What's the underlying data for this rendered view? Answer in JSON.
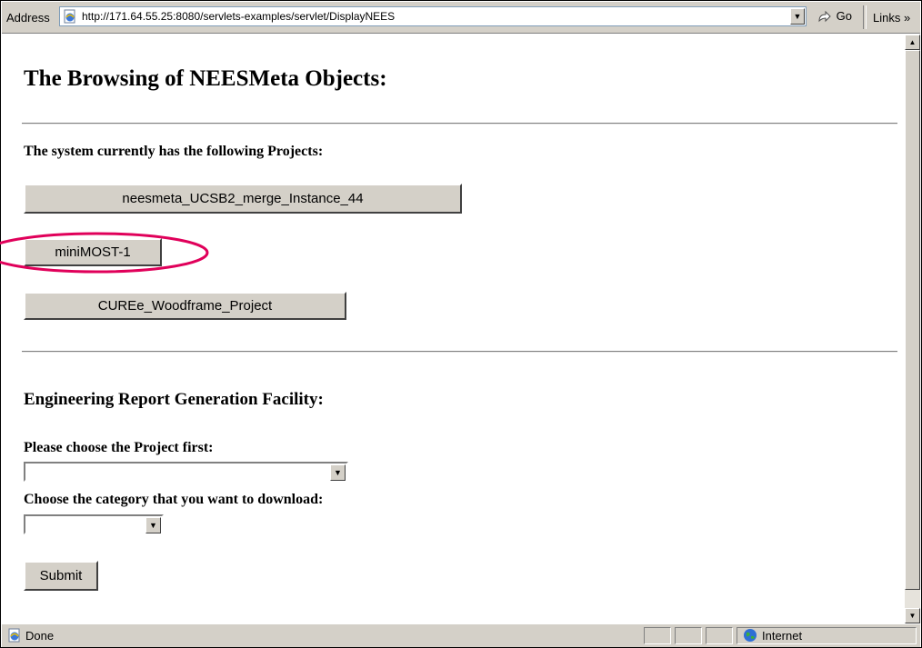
{
  "browser": {
    "address_label": "Address",
    "url": "http://171.64.55.25:8080/servlets-examples/servlet/DisplayNEES",
    "go_label": "Go",
    "links_label": "Links »"
  },
  "page": {
    "title": "The Browsing of NEESMeta Objects:",
    "projects_heading": "The system currently has the following Projects:",
    "projects": [
      "neesmeta_UCSB2_merge_Instance_44",
      "miniMOST-1",
      "CUREe_Woodframe_Project"
    ],
    "report_heading": "Engineering Report Generation Facility:",
    "project_select_label": "Please choose the Project first:",
    "project_select_value": "",
    "category_select_label": "Choose the category that you want to download:",
    "category_select_value": "",
    "submit_label": "Submit"
  },
  "status": {
    "text": "Done",
    "zone": "Internet"
  },
  "annotation": {
    "circle_color": "#e0005a"
  }
}
